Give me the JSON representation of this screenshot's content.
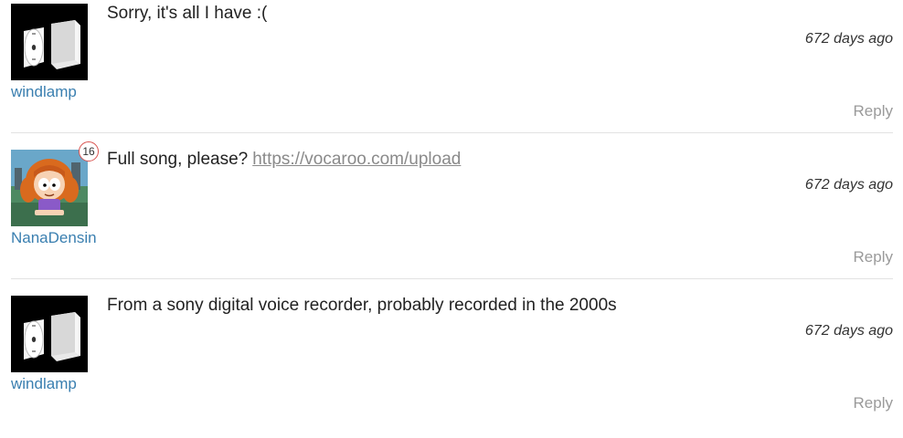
{
  "comments": [
    {
      "username": "windlamp",
      "text": "Sorry, it's all I have :(",
      "link": "",
      "timestamp": "672 days ago",
      "reply_label": "Reply",
      "avatar_icon": "wii-console-avatar"
    },
    {
      "username": "NanaDensin",
      "text": "Full song, please?",
      "link": "https://vocaroo.com/upload",
      "timestamp": "672 days ago",
      "reply_label": "Reply",
      "badge": "16",
      "avatar_icon": "cartoon-character-avatar"
    },
    {
      "username": "windlamp",
      "text": "From a sony digital voice recorder, probably recorded in the 2000s",
      "link": "",
      "timestamp": "672 days ago",
      "reply_label": "Reply",
      "avatar_icon": "wii-console-avatar"
    }
  ],
  "colors": {
    "username": "#3a7fb0",
    "link": "#8a8a8a",
    "reply": "#9a9a9a",
    "badge_border": "#d9534f"
  }
}
